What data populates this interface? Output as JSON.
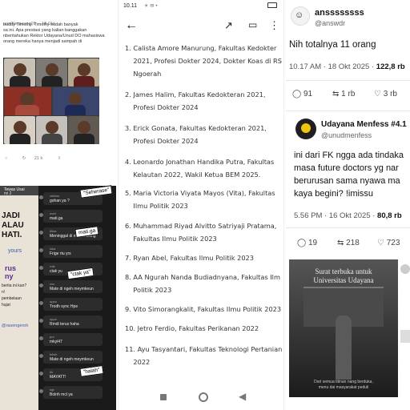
{
  "left": {
    "post_username": "uaniNerpaung09",
    "post_meta": "18 Okt",
    "post_lines": [
      "buddy Timothy. Timothy sudah banyak",
      "sa ini. Apa prestasi yang kalian banggakan",
      "nberitahukan Rektor Udayana/Unud DO mahasiswa",
      "orang mereka hanya menjadi sampah di"
    ],
    "post_count": "21 k",
    "chat_header_a": "Tewas Usai",
    "chat_header_b": "mi 2",
    "chat_side_texts": [
      "JADI",
      "ALAU",
      "HATI.",
      "yours",
      "rus",
      "ny",
      "berita ini kan?",
      "n!",
      "pembelaan",
      "hujat",
      "@rasengeroh"
    ],
    "chat_messages": [
      {
        "name": "cekiwo",
        "text": "gohan ya ?"
      },
      {
        "name": "oom",
        "text": "mati.ga"
      },
      {
        "name": "ditas",
        "text": "Meninggal di mereh doing"
      },
      {
        "name": "luka",
        "text": "Frige rtu yrs"
      },
      {
        "name": "rufs",
        "text": "ctak yu"
      },
      {
        "name": "xxo",
        "text": "Mate di ngeh meymkeun"
      },
      {
        "name": "oppo",
        "text": "Trodh sync Hpe"
      },
      {
        "name": "oppo",
        "text": "Rmdi terus haha"
      },
      {
        "name": "pro",
        "text": "mkyl47"
      },
      {
        "name": "fulish",
        "text": "Mate di ngeh meymkeun"
      },
      {
        "name": "dk",
        "text": "MAYATT!"
      },
      {
        "name": "ngr",
        "text": "Bolnh mcl ya"
      }
    ],
    "stickers": [
      "\"Seherase\"",
      "mati.ga",
      "\"ctak ya\"",
      "\"halah\""
    ]
  },
  "middle": {
    "status_time": "10.11",
    "list": [
      "1. Calista Amore Manurung, Fakultas Kedokter\n    2021, Profesi Dokter 2024, Dokter Koas di RS\n    Ngoerah",
      "2. James Halim, Fakultas Kedokteran 2021,\n    Profesi Dokter 2024",
      "3. Erick Gonata, Fakultas Kedokteran 2021,\n    Profesi Dokter 2024",
      "4. Leonardo Jonathan Handika Putra, Fakultas\n    Kelautan 2022, Wakil Ketua BEM 2025.",
      "5. Maria Victoria Viyata Mayos (Vita), Fakultas\n    Ilmu Politik 2023",
      "6. Muhammad Riyad Alvitto Satriyaji Pratama,\n    Fakultas Ilmu Politik 2023",
      "7. Ryan Abel, Fakultas Ilmu Politik 2023",
      "8. AA Ngurah Nanda Budiadnyana, Fakultas Ilm\n    Politik 2023",
      "9. Vito Simorangkalit, Fakultas Ilmu Politik 2023",
      "10. Jetro Ferdio, Fakultas Perikanan 2022",
      "11. Ayu Tasyantari, Fakultas Teknologi Pertanian\n    2022"
    ]
  },
  "right": {
    "tweet1": {
      "name": "anssssssss",
      "handle": "@answdr",
      "text": "Nih totalnya 11 orang",
      "meta": "10.17 AM · 18 Okt 2025 · ",
      "views": "122,8 rb",
      "replies": "91",
      "retweets": "1 rb",
      "likes": "3 rb"
    },
    "tweet2": {
      "name": "Udayana Menfess #4.1",
      "handle": "@unudmenfess",
      "lines": [
        "ini dari FK ngga ada tindaka",
        "masa future doctors yg nar",
        "berurusan sama nyawa ma",
        "kaya begini? !imissu"
      ],
      "meta": "5.56 PM · 16 Okt 2025 · ",
      "views": "80,8 rb",
      "replies": "19",
      "retweets": "218",
      "likes": "723"
    },
    "image_title_1": "Surat terbuka untuk",
    "image_title_2": "Universitas Udayana",
    "image_caption_1": "Dari semua titinan nang berduka,",
    "image_caption_2": "menu dai masyarakat peduli"
  }
}
